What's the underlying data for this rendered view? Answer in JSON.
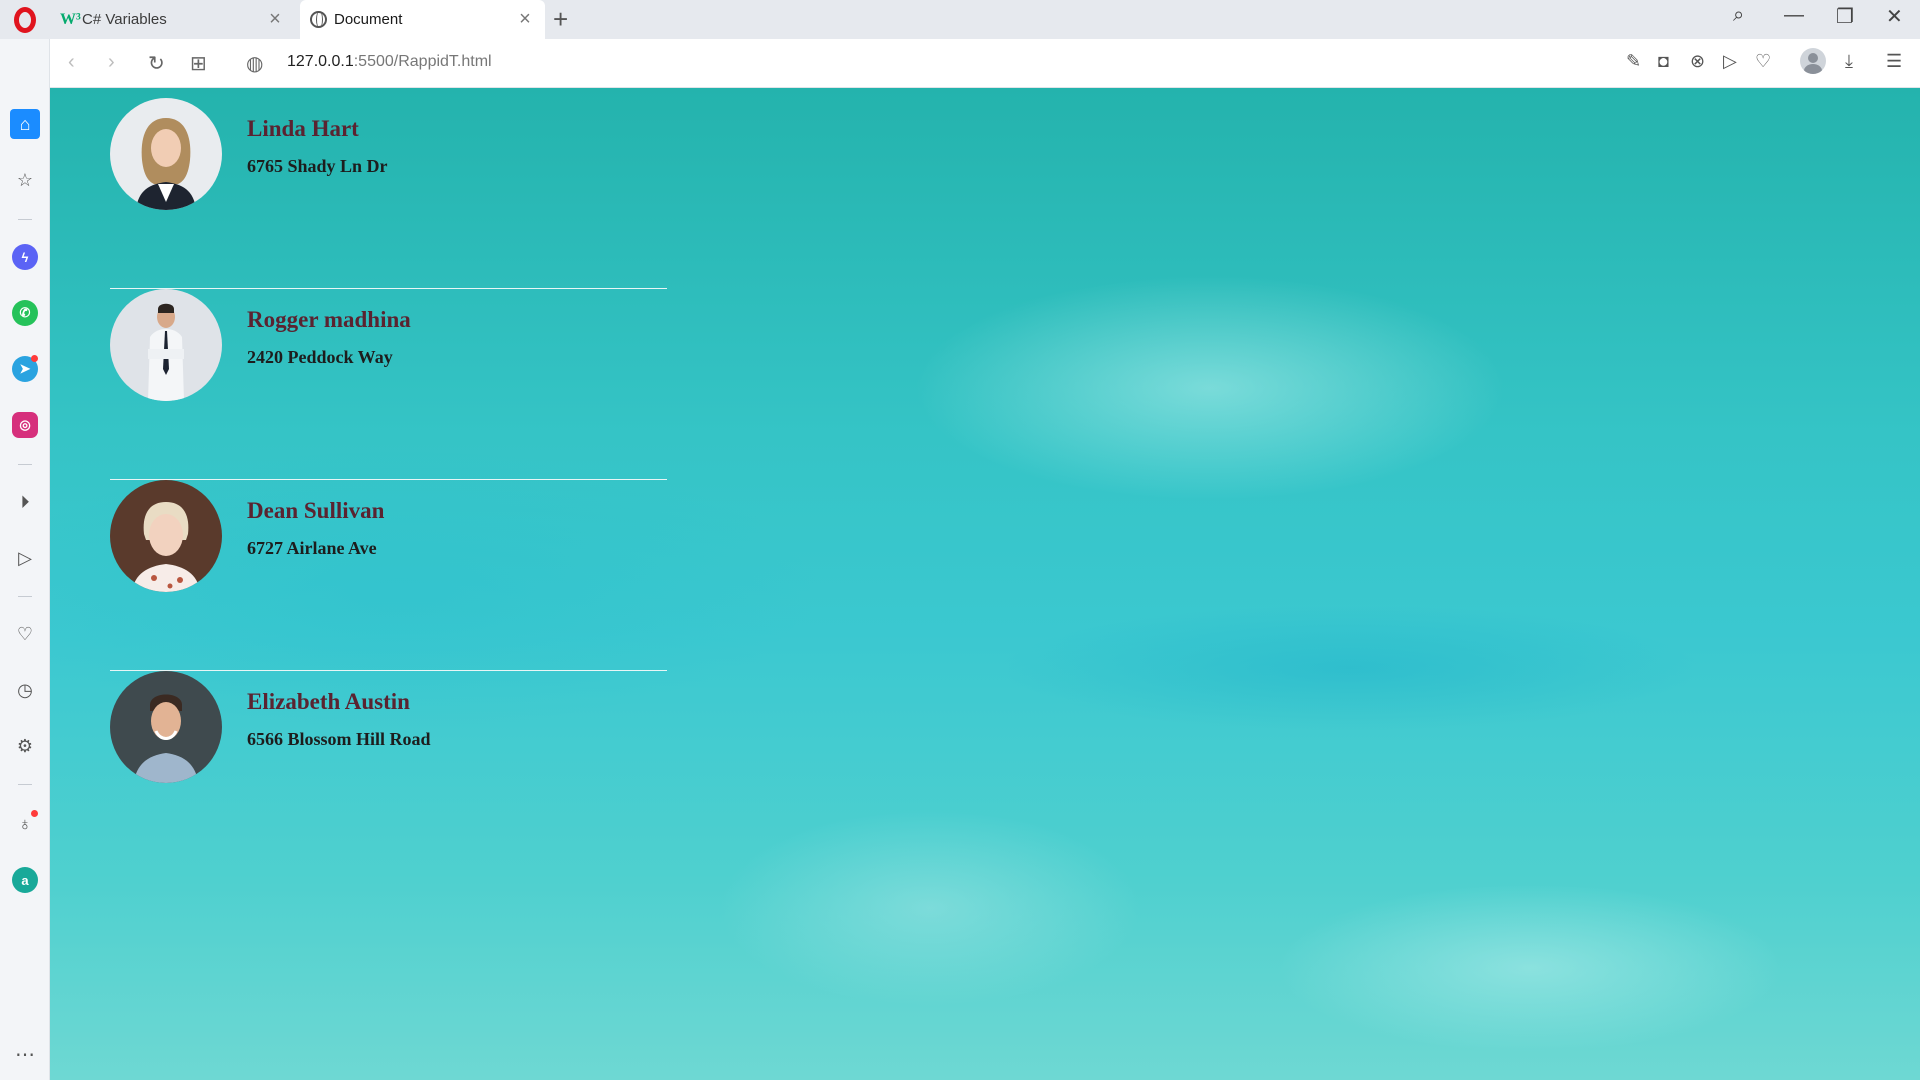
{
  "browser": {
    "tabs": [
      {
        "title": "C# Variables",
        "favicon": "w3schools-icon",
        "active": false
      },
      {
        "title": "Document",
        "favicon": "globe-icon",
        "active": true
      }
    ],
    "url_host": "127.0.0.1",
    "url_path": ":5500/RappidT.html"
  },
  "sidebar": {
    "items": [
      "home-icon",
      "star-icon",
      "messenger-icon",
      "whatsapp-icon",
      "telegram-icon",
      "instagram-icon",
      "player-icon",
      "send-icon",
      "heart-icon",
      "history-icon",
      "settings-icon",
      "lightbulb-icon",
      "aria-icon",
      "more-icon"
    ]
  },
  "contacts": [
    {
      "name": "Linda Hart",
      "address": "6765 Shady Ln Dr"
    },
    {
      "name": "Rogger madhina",
      "address": "2420 Peddock Way"
    },
    {
      "name": "Dean Sullivan",
      "address": "6727 Airlane Ave"
    },
    {
      "name": "Elizabeth Austin",
      "address": "6566 Blossom Hill Road"
    }
  ],
  "colors": {
    "name": "#5a2330",
    "address": "#1d1d1d",
    "background": "#3bc8d0",
    "opera_red": "#e0141e",
    "home_blue": "#1b8cff"
  }
}
